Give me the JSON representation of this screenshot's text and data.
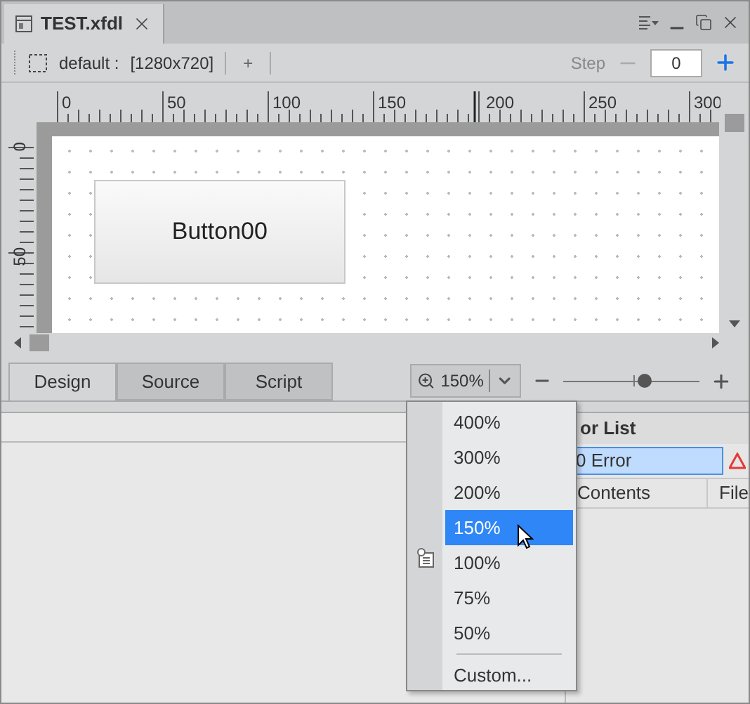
{
  "document_tab": {
    "title": "TEST.xfdl"
  },
  "toolbar": {
    "layout_name": "default :",
    "resolution": "[1280x720]",
    "add_label": "+",
    "step_label": "Step",
    "step_value": "0"
  },
  "ruler": {
    "x_labels": [
      "0",
      "50",
      "100",
      "150",
      "200",
      "250",
      "300"
    ],
    "y_labels": [
      "0",
      "50"
    ]
  },
  "canvas": {
    "components": [
      {
        "kind": "button",
        "label": "Button00"
      }
    ]
  },
  "view_tabs": [
    {
      "label": "Design",
      "selected": true
    },
    {
      "label": "Source",
      "selected": false
    },
    {
      "label": "Script",
      "selected": false
    }
  ],
  "zoom": {
    "value": "150%",
    "level": 0.6
  },
  "zoom_menu": {
    "items": [
      {
        "label": "400%",
        "selected": false
      },
      {
        "label": "300%",
        "selected": false
      },
      {
        "label": "200%",
        "selected": false
      },
      {
        "label": "150%",
        "selected": true
      },
      {
        "label": "100%",
        "selected": false
      },
      {
        "label": "75%",
        "selected": false
      },
      {
        "label": "50%",
        "selected": false
      },
      {
        "label": "Custom...",
        "selected": false
      }
    ]
  },
  "error_list": {
    "title": "or List",
    "filter": "0 Error",
    "columns": [
      "Contents",
      "File"
    ]
  }
}
